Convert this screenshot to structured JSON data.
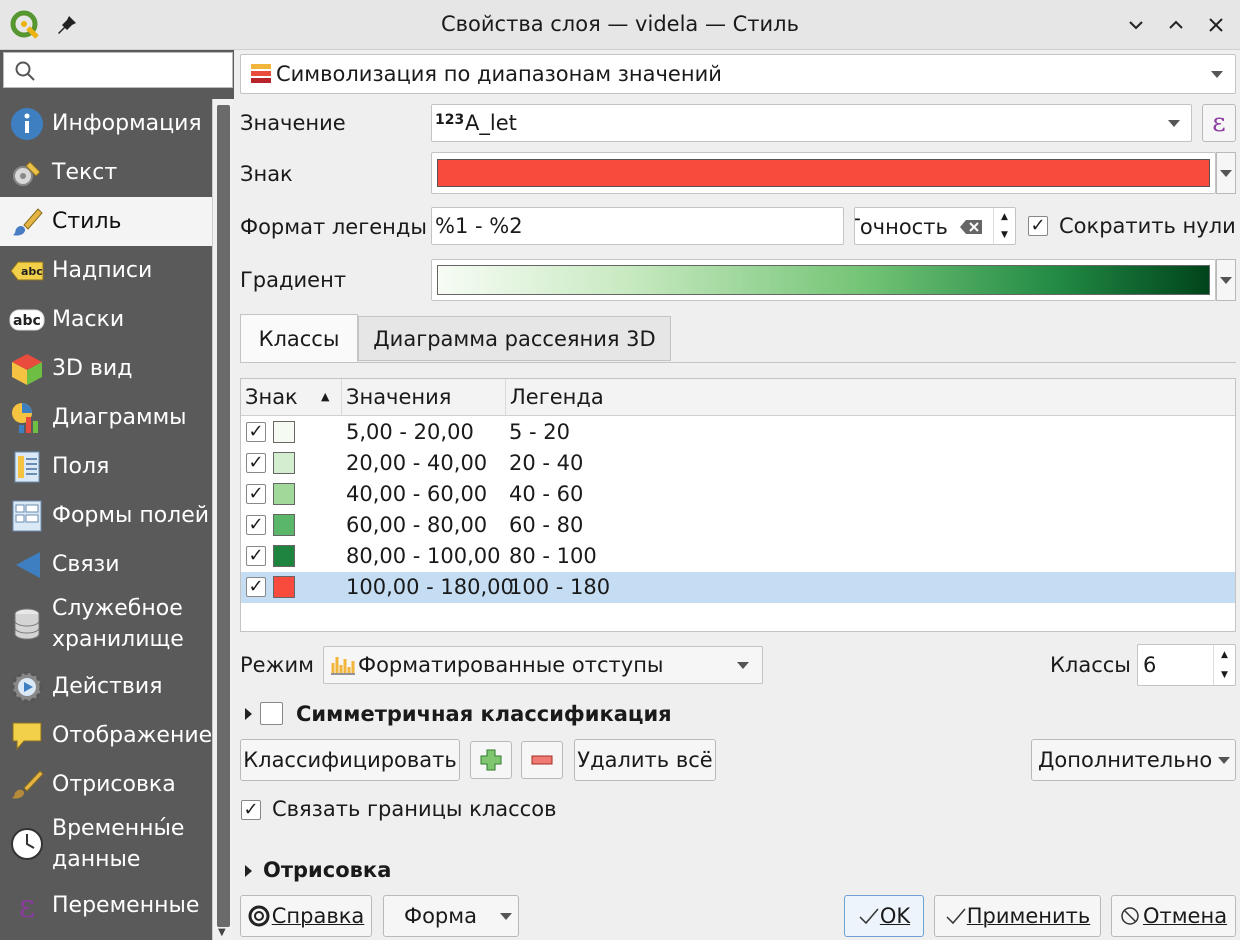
{
  "window": {
    "title": "Свойства слоя — videla — Стиль"
  },
  "sidebar": {
    "search_placeholder": "",
    "items": [
      {
        "label": "Информация",
        "icon": "info-icon"
      },
      {
        "label": "Текст",
        "icon": "source-settings-icon"
      },
      {
        "label": "Стиль",
        "icon": "paintbrush-icon",
        "active": true
      },
      {
        "label": "Надписи",
        "icon": "labels-abc-icon"
      },
      {
        "label": "Маски",
        "icon": "masks-abc-icon"
      },
      {
        "label": "3D вид",
        "icon": "cube-3d-icon"
      },
      {
        "label": "Диаграммы",
        "icon": "diagram-icon"
      },
      {
        "label": "Поля",
        "icon": "fields-table-icon"
      },
      {
        "label": "Формы полей",
        "icon": "attribute-form-icon"
      },
      {
        "label": "Связи",
        "icon": "joins-icon"
      },
      {
        "label": "Служебное хранилище",
        "icon": "auxiliary-storage-icon"
      },
      {
        "label": "Действия",
        "icon": "actions-gear-icon"
      },
      {
        "label": "Отображение",
        "icon": "display-speech-bubble-icon"
      },
      {
        "label": "Отрисовка",
        "icon": "rendering-brush-icon"
      },
      {
        "label": "Временны́е данные",
        "icon": "temporal-clock-icon"
      },
      {
        "label": "Переменные",
        "icon": "variables-epsilon-icon"
      }
    ]
  },
  "renderer": {
    "type": "Символизация по диапазонам значений"
  },
  "value": {
    "label": "Значение",
    "field_type": "123",
    "field": "A_let"
  },
  "symbol": {
    "label": "Знак",
    "color": "#f94a3e"
  },
  "legend_format": {
    "label": "Формат легенды",
    "value": "%1 - %2",
    "precision_label": "Точность",
    "trim_label": "Сократить нули",
    "trim_checked": true
  },
  "gradient": {
    "label": "Градиент"
  },
  "tabs": [
    {
      "label": "Классы"
    },
    {
      "label": "Диаграмма рассеяния 3D"
    }
  ],
  "table": {
    "headers": [
      "Знак",
      "Значения",
      "Легенда"
    ],
    "rows": [
      {
        "checked": true,
        "color": "#f5fbf2",
        "values": "5,00 - 20,00",
        "legend": "5 - 20"
      },
      {
        "checked": true,
        "color": "#d4edd0",
        "values": "20,00 - 40,00",
        "legend": "20 - 40"
      },
      {
        "checked": true,
        "color": "#a1d99b",
        "values": "40,00 - 60,00",
        "legend": "40 - 60"
      },
      {
        "checked": true,
        "color": "#5ab769",
        "values": "60,00 - 80,00",
        "legend": "60 - 80"
      },
      {
        "checked": true,
        "color": "#1e8440",
        "values": "80,00 - 100,00",
        "legend": "80 - 100"
      },
      {
        "checked": true,
        "color": "#f94a3e",
        "values": "100,00 - 180,00",
        "legend": "100 - 180",
        "selected": true
      }
    ]
  },
  "mode": {
    "label": "Режим",
    "value": "Форматированные отступы"
  },
  "classes": {
    "label": "Классы",
    "value": "6"
  },
  "symmetric": {
    "label": "Симметричная классификация",
    "checked": false
  },
  "buttons": {
    "classify": "Классифицировать",
    "delete_all": "Удалить всё",
    "advanced": "Дополнительно"
  },
  "link_bounds": {
    "label": "Связать границы классов",
    "checked": true
  },
  "rendering_section": {
    "label": "Отрисовка"
  },
  "footer": {
    "help": "Справка",
    "style": "Форма",
    "ok": "OK",
    "apply": "Применить",
    "cancel": "Отмена"
  }
}
